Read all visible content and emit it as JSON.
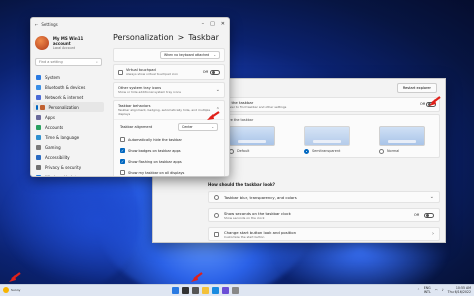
{
  "settings": {
    "title": "Settings",
    "profile": {
      "name": "My MS Win11 account",
      "account": "Local Account"
    },
    "search_placeholder": "Find a setting",
    "nav": [
      {
        "label": "System",
        "color": "#2a7ae2"
      },
      {
        "label": "Bluetooth & devices",
        "color": "#3a8ee6"
      },
      {
        "label": "Network & internet",
        "color": "#4a6bd6"
      },
      {
        "label": "Personalization",
        "color": "#c06030",
        "active": true
      },
      {
        "label": "Apps",
        "color": "#6a6a9a"
      },
      {
        "label": "Accounts",
        "color": "#2aa060"
      },
      {
        "label": "Time & language",
        "color": "#3090d0"
      },
      {
        "label": "Gaming",
        "color": "#7a7a7a"
      },
      {
        "label": "Accessibility",
        "color": "#2a6ac0"
      },
      {
        "label": "Privacy & security",
        "color": "#707070"
      },
      {
        "label": "Windows Update",
        "color": "#1e7ad8"
      }
    ],
    "breadcrumb": {
      "parent": "Personalization",
      "sep": ">",
      "current": "Taskbar"
    },
    "keyboard_dropdown": "When no keyboard attached",
    "virtual_touchpad": {
      "label": "Virtual touchpad",
      "desc": "Always show virtual touchpad icon",
      "state": "Off"
    },
    "other_tray": {
      "label": "Other system tray icons",
      "desc": "Show or hide additional system tray icons"
    },
    "behaviors": {
      "label": "Taskbar behaviors",
      "desc": "Taskbar alignment, badging, automatically hide, and multiple displays"
    },
    "alignment": {
      "label": "Taskbar alignment",
      "value": "Center"
    },
    "options": [
      {
        "label": "Automatically hide the taskbar",
        "checked": false
      },
      {
        "label": "Show badges on taskbar apps",
        "checked": true
      },
      {
        "label": "Show flashing on taskbar apps",
        "checked": true
      },
      {
        "label": "Show my taskbar on all displays",
        "checked": false
      }
    ]
  },
  "back_window": {
    "heading": "ar",
    "restart_button": "Restart explorer",
    "enhance": {
      "title": "enhance the taskbar",
      "desc": "Make it easier to find taskbar and other settings",
      "state": "Off"
    },
    "customize_label": "Customize the taskbar",
    "radio_options": [
      "Default",
      "Semitransparent",
      "Normal"
    ],
    "section_title": "How should the taskbar look?",
    "rows": [
      {
        "label": "Taskbar blur, transparency, and colors",
        "right": ""
      },
      {
        "label": "Show seconds on the taskbar clock",
        "desc": "Show seconds on the clock",
        "right": "Off"
      },
      {
        "label": "Change start button look and position",
        "desc": "Customize the start button",
        "right": ""
      }
    ]
  },
  "taskbar": {
    "weather": "Sunny",
    "lang": "ENG\nINTL",
    "time": "10:55 AM",
    "date": "Thu 6/16/2022"
  }
}
